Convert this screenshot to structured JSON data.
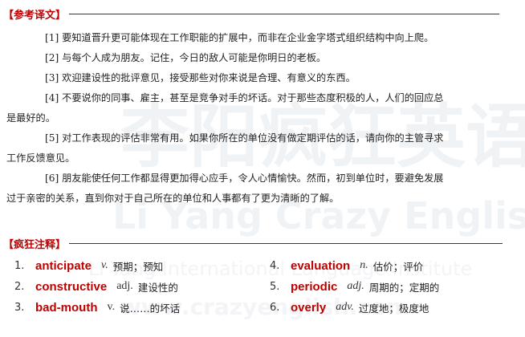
{
  "translation_title": "【参考译文】",
  "notes_title": "【疯狂注释】",
  "paragraphs": [
    {
      "num": "[1]",
      "text": "要知道晋升更可能体现在工作职能的扩展中，而非在企业金字塔式组织结构中向上爬。"
    },
    {
      "num": "[2]",
      "text": "与每个人成为朋友。记住，今日的敌人可能是你明日的老板。"
    },
    {
      "num": "[3]",
      "text": "欢迎建设性的批评意见，接受那些对你来说是合理、有意义的东西。"
    },
    {
      "num": "[4]",
      "line1": "不要说你的同事、雇主，甚至是竞争对手的坏话。对于那些态度积极的人，人们的回应总",
      "line2": "是最好的。"
    },
    {
      "num": "[5]",
      "line1": "对工作表现的评估非常有用。如果你所在的单位没有做定期评估的话，请向你的主管寻求",
      "line2": "工作反馈意见。"
    },
    {
      "num": "[6]",
      "line1": "朋友能使任何工作都显得更加得心应手，令人心情愉快。然而，初到单位时，要避免发展",
      "line2": "过于亲密的关系，直到你对于自己所在的单位和人事都有了更为清晰的了解。"
    }
  ],
  "notes": [
    {
      "idx": "1.",
      "word": "anticipate",
      "pos": "v.",
      "def": "预期；预知"
    },
    {
      "idx": "2.",
      "word": "constructive",
      "pos": "adj.",
      "def": "建设性的"
    },
    {
      "idx": "3.",
      "word": "bad-mouth",
      "pos": "v.",
      "def": "说……的坏话"
    },
    {
      "idx": "4.",
      "word": "evaluation",
      "pos": "n.",
      "def": "估价；评价"
    },
    {
      "idx": "5.",
      "word": "periodic",
      "pos": "adj.",
      "def": "周期的；定期的"
    },
    {
      "idx": "6.",
      "word": "overly",
      "pos": "adv.",
      "def": "过度地；极度地"
    }
  ],
  "watermark": {
    "cn": "李阳疯狂英语",
    "en": "Li Yang Crazy English",
    "institute": "Li Yang International Language Institute",
    "url": "www.crazyenglish.com"
  }
}
